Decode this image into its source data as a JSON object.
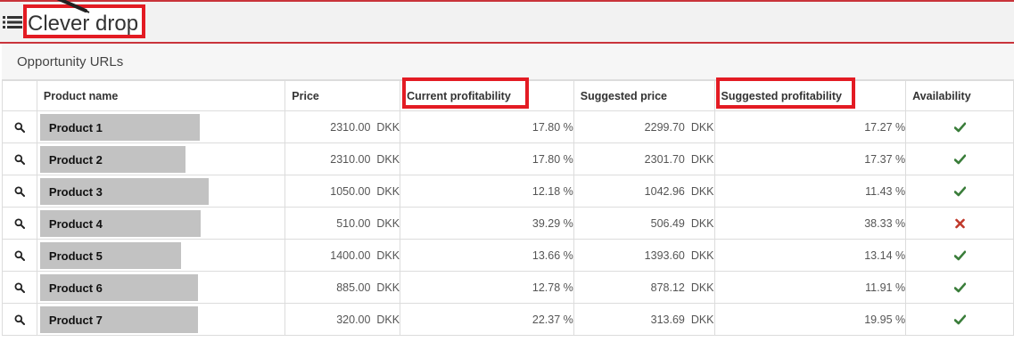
{
  "app": {
    "title": "Clever drop",
    "colors": {
      "accent": "#c9343b",
      "highlight": "#e31b23",
      "check": "#3a7d3a",
      "cross": "#c0392b",
      "product_bar": "#c2c2c2"
    }
  },
  "panel": {
    "title": "Opportunity URLs"
  },
  "table": {
    "columns": {
      "search": "",
      "product_name": "Product name",
      "price": "Price",
      "current_profitability": "Current profitability",
      "suggested_price": "Suggested price",
      "suggested_profitability": "Suggested profitability",
      "availability": "Availability"
    },
    "currency": "DKK",
    "rows": [
      {
        "product": "Product 1",
        "price": "2310.00",
        "current_profitability": "17.80 %",
        "suggested_price": "2299.70",
        "suggested_profitability": "17.27 %",
        "available": true
      },
      {
        "product": "Product 2",
        "price": "2310.00",
        "current_profitability": "17.80 %",
        "suggested_price": "2301.70",
        "suggested_profitability": "17.37 %",
        "available": true
      },
      {
        "product": "Product 3",
        "price": "1050.00",
        "current_profitability": "12.18 %",
        "suggested_price": "1042.96",
        "suggested_profitability": "11.43 %",
        "available": true
      },
      {
        "product": "Product 4",
        "price": "510.00",
        "current_profitability": "39.29 %",
        "suggested_price": "506.49",
        "suggested_profitability": "38.33 %",
        "available": false
      },
      {
        "product": "Product 5",
        "price": "1400.00",
        "current_profitability": "13.66 %",
        "suggested_price": "1393.60",
        "suggested_profitability": "13.14 %",
        "available": true
      },
      {
        "product": "Product 6",
        "price": "885.00",
        "current_profitability": "12.78 %",
        "suggested_price": "878.12",
        "suggested_profitability": "11.91 %",
        "available": true
      },
      {
        "product": "Product 7",
        "price": "320.00",
        "current_profitability": "22.37 %",
        "suggested_price": "313.69",
        "suggested_profitability": "19.95 %",
        "available": true
      }
    ]
  }
}
